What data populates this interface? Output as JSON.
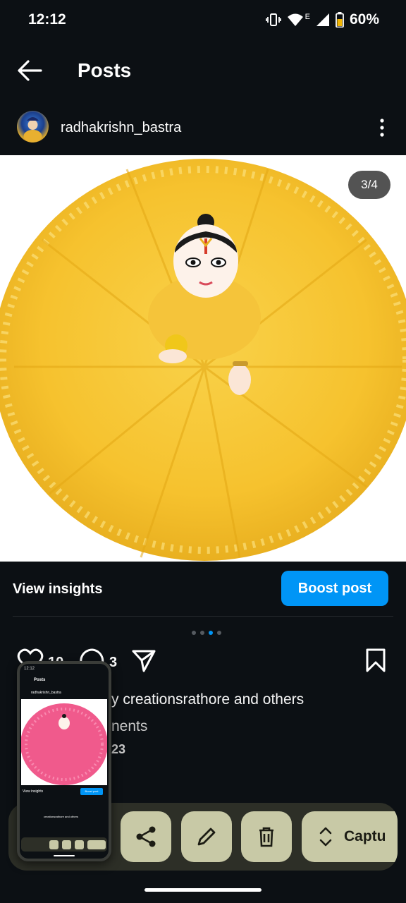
{
  "status_bar": {
    "time": "12:12",
    "network_type": "E",
    "battery_percent": "60%",
    "icons": [
      "vibrate-icon",
      "wifi-icon",
      "signal-icon",
      "battery-icon"
    ]
  },
  "header": {
    "title": "Posts",
    "back_icon": "arrow-left-icon"
  },
  "post": {
    "username": "radhakrishn_bastra",
    "page_indicator": "3/4",
    "carousel": {
      "total": 4,
      "active": 3
    },
    "like_count": "10",
    "comment_count": "3",
    "liked_by_text": "y creationsrathore and others",
    "comments_text": "nents",
    "date_text": "23"
  },
  "insights": {
    "label": "View insights",
    "boost_label": "Boost post"
  },
  "screenshot_toolbar": {
    "buttons": [
      "share-icon",
      "edit-icon",
      "delete-icon"
    ],
    "capture_label": "Captu"
  },
  "thumbnail": {
    "status_time": "12:12",
    "title": "Posts",
    "username": "radhakrishn_bastra",
    "insights_label": "View insights",
    "boost_label": "Boost post",
    "liked_by_text": "creationsrathore and others"
  },
  "colors": {
    "background": "#0c1014",
    "accent": "#0095f6",
    "toolbar": "#2d2f27",
    "toolbar_button": "#c8c9a6",
    "fur": "#f7c531"
  }
}
